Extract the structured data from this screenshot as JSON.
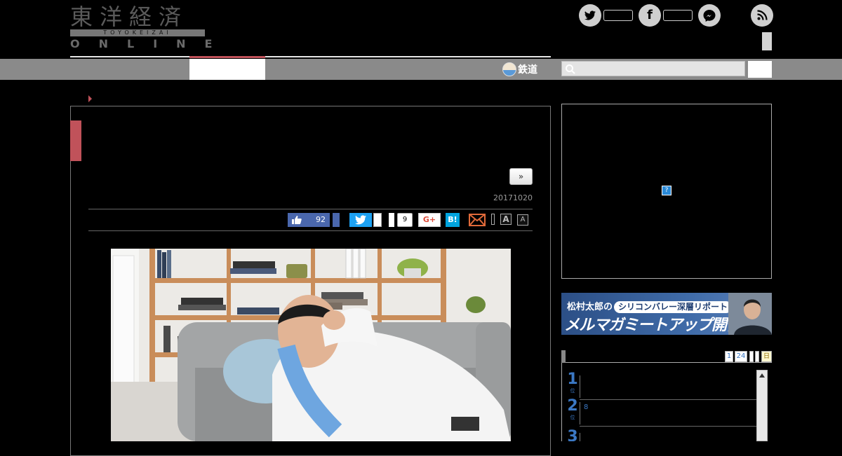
{
  "header": {
    "logo": {
      "kanji": "東洋経済",
      "romaji": "TOYOKEIZAI",
      "online": "ONLINE"
    },
    "sns": {
      "twitter_glyph": "t",
      "facebook_glyph": "f"
    }
  },
  "nav": {
    "railway_label": "鉄道"
  },
  "article": {
    "next_page_label": "»",
    "date": "20171020",
    "share": {
      "like_count": "92",
      "facebook_share_count": "9",
      "gplus_label": "G+",
      "hatena_label": "B!"
    },
    "font_size_large": "A",
    "font_size_small": "A"
  },
  "sidebar": {
    "ad_info_label": "?",
    "banner": {
      "line1_prefix": "松村太郎の",
      "line1_pill": "シリコンバレー深層リポート",
      "line2": "メルマガミートアップ開催"
    },
    "ranking": {
      "tabs": [
        "1",
        "24",
        "",
        "",
        "日"
      ],
      "rows": [
        {
          "rank": "1",
          "suffix": "位",
          "meta": ""
        },
        {
          "rank": "2",
          "suffix": "位",
          "meta": "8"
        },
        {
          "rank": "3",
          "suffix": "位",
          "meta": ""
        }
      ]
    }
  },
  "colors": {
    "accent": "#c0525a",
    "nav_gray": "#8a8a8a",
    "link_blue": "#3b78c4"
  }
}
